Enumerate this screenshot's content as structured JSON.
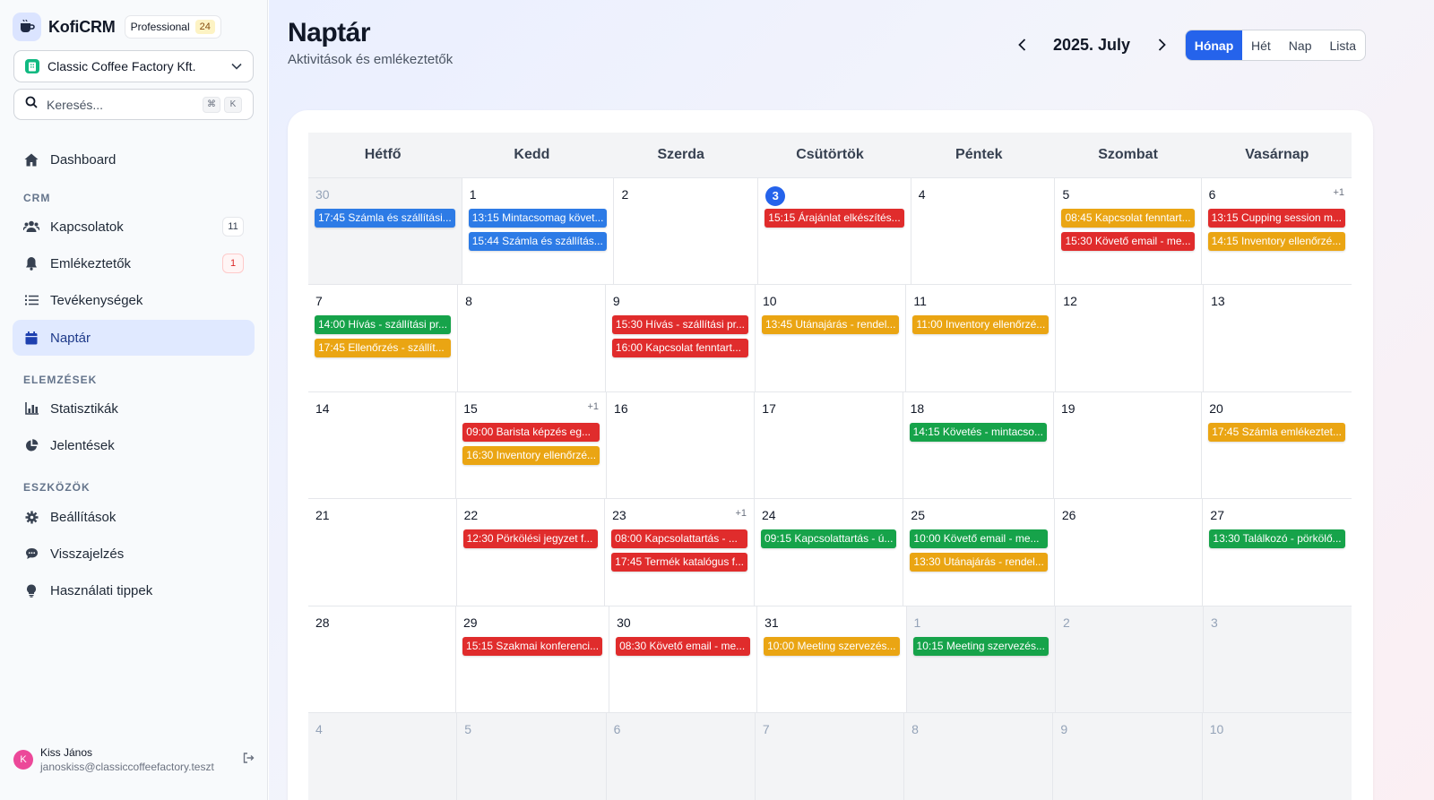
{
  "brand": {
    "name": "KofiCRM",
    "plan": "Professional",
    "plan_count": "24"
  },
  "org": {
    "name": "Classic Coffee Factory Kft."
  },
  "search": {
    "placeholder": "Keresés...",
    "kbd1": "⌘",
    "kbd2": "K"
  },
  "nav": {
    "dashboard": "Dashboard",
    "crm_title": "CRM",
    "contacts": "Kapcsolatok",
    "contacts_count": "11",
    "reminders": "Emlékeztetők",
    "reminders_count": "1",
    "activities": "Tevékenységek",
    "calendar": "Naptár",
    "analytics_title": "ELEMZÉSEK",
    "statistics": "Statisztikák",
    "reports": "Jelentések",
    "tools_title": "ESZKÖZÖK",
    "settings": "Beállítások",
    "feedback": "Visszajelzés",
    "tips": "Használati tippek"
  },
  "user": {
    "initial": "K",
    "name": "Kiss János",
    "email": "janoskiss@classiccoffeefactory.teszt"
  },
  "header": {
    "title": "Naptár",
    "subtitle": "Aktivitások és emlékeztetők",
    "month": "2025. July",
    "views": [
      "Hónap",
      "Hét",
      "Nap",
      "Lista"
    ]
  },
  "calendar": {
    "weekdays": [
      "Hétfő",
      "Kedd",
      "Szerda",
      "Csütörtök",
      "Péntek",
      "Szombat",
      "Vasárnap"
    ],
    "weeks": [
      [
        {
          "day": "30",
          "other": true,
          "events": [
            {
              "text": "17:45 Számla és szállítási...",
              "color": "blue"
            }
          ]
        },
        {
          "day": "1",
          "events": [
            {
              "text": "13:15 Mintacsomag követ...",
              "color": "blue"
            },
            {
              "text": "15:44 Számla és szállítás...",
              "color": "blue"
            }
          ]
        },
        {
          "day": "2",
          "events": []
        },
        {
          "day": "3",
          "today": true,
          "events": [
            {
              "text": "15:15 Árajánlat elkészítés...",
              "color": "red"
            }
          ]
        },
        {
          "day": "4",
          "events": []
        },
        {
          "day": "5",
          "events": [
            {
              "text": "08:45 Kapcsolat fenntart...",
              "color": "amber"
            },
            {
              "text": "15:30 Követő email - me...",
              "color": "red"
            }
          ]
        },
        {
          "day": "6",
          "more": "+1",
          "events": [
            {
              "text": "13:15 Cupping session m...",
              "color": "red"
            },
            {
              "text": "14:15 Inventory ellenőrzé...",
              "color": "amber"
            }
          ]
        }
      ],
      [
        {
          "day": "7",
          "events": [
            {
              "text": "14:00 Hívás - szállítási pr...",
              "color": "green"
            },
            {
              "text": "17:45 Ellenőrzés - szállít...",
              "color": "amber"
            }
          ]
        },
        {
          "day": "8",
          "events": []
        },
        {
          "day": "9",
          "events": [
            {
              "text": "15:30 Hívás - szállítási pr...",
              "color": "red"
            },
            {
              "text": "16:00 Kapcsolat fenntart...",
              "color": "red"
            }
          ]
        },
        {
          "day": "10",
          "events": [
            {
              "text": "13:45 Utánajárás - rendel...",
              "color": "amber"
            }
          ]
        },
        {
          "day": "11",
          "events": [
            {
              "text": "11:00 Inventory ellenőrzé...",
              "color": "amber"
            }
          ]
        },
        {
          "day": "12",
          "events": []
        },
        {
          "day": "13",
          "events": []
        }
      ],
      [
        {
          "day": "14",
          "events": []
        },
        {
          "day": "15",
          "more": "+1",
          "events": [
            {
              "text": "09:00 Barista képzés eg...",
              "color": "red"
            },
            {
              "text": "16:30 Inventory ellenőrzé...",
              "color": "amber"
            }
          ]
        },
        {
          "day": "16",
          "events": []
        },
        {
          "day": "17",
          "events": []
        },
        {
          "day": "18",
          "events": [
            {
              "text": "14:15 Követés - mintacso...",
              "color": "green"
            }
          ]
        },
        {
          "day": "19",
          "events": []
        },
        {
          "day": "20",
          "events": [
            {
              "text": "17:45 Számla emlékeztet...",
              "color": "amber"
            }
          ]
        }
      ],
      [
        {
          "day": "21",
          "events": []
        },
        {
          "day": "22",
          "events": [
            {
              "text": "12:30 Pörkölési jegyzet f...",
              "color": "red"
            }
          ]
        },
        {
          "day": "23",
          "more": "+1",
          "events": [
            {
              "text": "08:00 Kapcsolattartás - ...",
              "color": "red"
            },
            {
              "text": "17:45 Termék katalógus f...",
              "color": "red"
            }
          ]
        },
        {
          "day": "24",
          "events": [
            {
              "text": "09:15 Kapcsolattartás - ú...",
              "color": "green"
            }
          ]
        },
        {
          "day": "25",
          "events": [
            {
              "text": "10:00 Követő email - me...",
              "color": "green"
            },
            {
              "text": "13:30 Utánajárás - rendel...",
              "color": "amber"
            }
          ]
        },
        {
          "day": "26",
          "events": []
        },
        {
          "day": "27",
          "events": [
            {
              "text": "13:30 Találkozó - pörkölő...",
              "color": "green"
            }
          ]
        }
      ],
      [
        {
          "day": "28",
          "events": []
        },
        {
          "day": "29",
          "events": [
            {
              "text": "15:15 Szakmai konferenci...",
              "color": "red"
            }
          ]
        },
        {
          "day": "30",
          "events": [
            {
              "text": "08:30 Követő email - me...",
              "color": "red"
            }
          ]
        },
        {
          "day": "31",
          "events": [
            {
              "text": "10:00 Meeting szervezés...",
              "color": "amber"
            }
          ]
        },
        {
          "day": "1",
          "other": true,
          "events": [
            {
              "text": "10:15 Meeting szervezés...",
              "color": "green"
            }
          ]
        },
        {
          "day": "2",
          "other": true,
          "events": []
        },
        {
          "day": "3",
          "other": true,
          "events": []
        }
      ],
      [
        {
          "day": "4",
          "other": true,
          "events": []
        },
        {
          "day": "5",
          "other": true,
          "events": []
        },
        {
          "day": "6",
          "other": true,
          "events": []
        },
        {
          "day": "7",
          "other": true,
          "events": []
        },
        {
          "day": "8",
          "other": true,
          "events": []
        },
        {
          "day": "9",
          "other": true,
          "events": []
        },
        {
          "day": "10",
          "other": true,
          "events": []
        }
      ]
    ]
  },
  "colors": {
    "accent": "#2563eb",
    "red": "#e02c2c",
    "amber": "#eaa513",
    "green": "#16a34a",
    "blue": "#2d7be6"
  }
}
